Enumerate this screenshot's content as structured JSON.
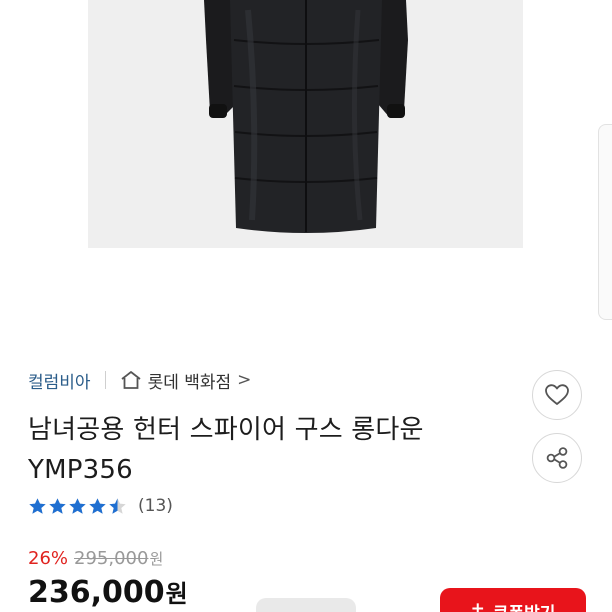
{
  "product": {
    "brand": "컬럼비아",
    "store": "롯데 백화점",
    "store_chevron": ">",
    "title_line1": "남녀공용 헌터 스파이어 구스 롱다운",
    "title_line2": "YMP356",
    "rating": 4.5,
    "review_count": "(13)",
    "discount": "26%",
    "original_price": "295,000",
    "original_price_unit": "원",
    "price": "236,000",
    "price_unit": "원"
  },
  "actions": {
    "coupon_plus": "+",
    "coupon_label": "쿠폰받기"
  },
  "icons": {
    "store": "store-icon",
    "like": "heart-icon",
    "share": "share-icon",
    "star": "star-icon"
  },
  "colors": {
    "brand": "#2b5d8a",
    "discount": "#e0231f",
    "star": "#1f6fd1",
    "coupon": "#e8141b"
  }
}
